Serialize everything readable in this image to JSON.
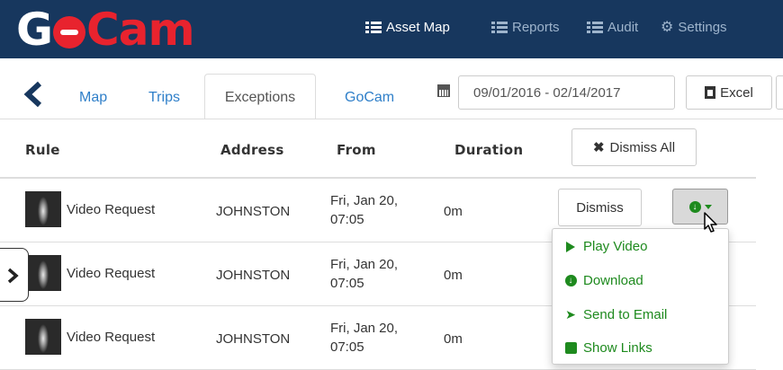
{
  "nav": {
    "logo_prefix": "G",
    "logo_suffix": "Cam",
    "links": [
      {
        "label": "Asset Map",
        "active": true,
        "icon": "list-icon"
      },
      {
        "label": "Reports",
        "active": false,
        "icon": "list-icon"
      },
      {
        "label": "Audit",
        "active": false,
        "icon": "list-icon"
      },
      {
        "label": "Settings",
        "active": false,
        "icon": "gear-icon"
      }
    ]
  },
  "tabs": {
    "items": [
      "Map",
      "Trips",
      "Exceptions",
      "GoCam"
    ],
    "active": "Exceptions"
  },
  "toolbar": {
    "date_range": "09/01/2016 - 02/14/2017",
    "excel_label": "Excel"
  },
  "table": {
    "headers": {
      "rule": "Rule",
      "address": "Address",
      "from": "From",
      "duration": "Duration"
    },
    "dismiss_all_label": "Dismiss All",
    "rows": [
      {
        "rule": "Video Request",
        "address": "JOHNSTON",
        "from_line1": "Fri, Jan 20,",
        "from_line2": "07:05",
        "duration": "0m",
        "dismiss_label": "Dismiss"
      },
      {
        "rule": "Video Request",
        "address": "JOHNSTON",
        "from_line1": "Fri, Jan 20,",
        "from_line2": "07:05",
        "duration": "0m"
      },
      {
        "rule": "Video Request",
        "address": "JOHNSTON",
        "from_line1": "Fri, Jan 20,",
        "from_line2": "07:05",
        "duration": "0m"
      }
    ]
  },
  "menu": {
    "items": [
      "Play Video",
      "Download",
      "Send to Email",
      "Show Links"
    ]
  },
  "colors": {
    "navbar": "#17375e",
    "brand_red": "#e8232e",
    "link_blue": "#2f7fc9",
    "menu_green": "#1e8a1e"
  }
}
